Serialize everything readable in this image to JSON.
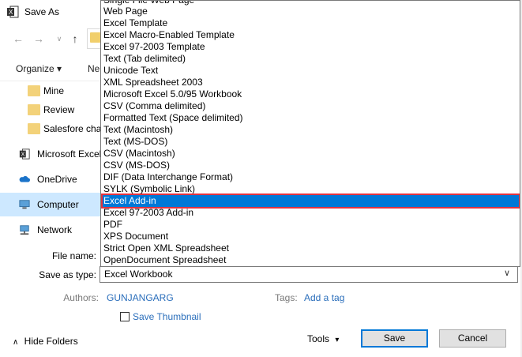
{
  "window": {
    "title": "Save As"
  },
  "nav": {
    "items": [
      {
        "label": "Mine",
        "icon": "folder-icon"
      },
      {
        "label": "Review",
        "icon": "folder-icon"
      },
      {
        "label": "Salesfore chal",
        "icon": "folder-icon"
      },
      {
        "label": "Microsoft Excel",
        "icon": "excel-icon"
      },
      {
        "label": "OneDrive",
        "icon": "cloud-icon"
      },
      {
        "label": "Computer",
        "icon": "computer-icon",
        "selected": true
      },
      {
        "label": "Network",
        "icon": "network-icon"
      }
    ]
  },
  "toolbar": {
    "organize": "Organize ▾",
    "new_folder": "Ne"
  },
  "dropdown": {
    "top_partial": "Single File Web Page",
    "items": [
      "Web Page",
      "Excel Template",
      "Excel Macro-Enabled Template",
      "Excel 97-2003 Template",
      "Text (Tab delimited)",
      "Unicode Text",
      "XML Spreadsheet 2003",
      "Microsoft Excel 5.0/95 Workbook",
      "CSV (Comma delimited)",
      "Formatted Text (Space delimited)",
      "Text (Macintosh)",
      "Text (MS-DOS)",
      "CSV (Macintosh)",
      "CSV (MS-DOS)",
      "DIF (Data Interchange Format)",
      "SYLK (Symbolic Link)",
      "Excel Add-in",
      "Excel 97-2003 Add-in",
      "PDF",
      "XPS Document",
      "Strict Open XML Spreadsheet",
      "OpenDocument Spreadsheet"
    ],
    "selected": "Excel Add-in"
  },
  "form": {
    "file_name_label": "File name:",
    "save_as_type_label": "Save as type:",
    "save_as_type_value": "Excel Workbook",
    "authors_label": "Authors:",
    "authors_value": "GUNJANGARG",
    "tags_label": "Tags:",
    "tags_value": "Add a tag",
    "save_thumbnail_label": "Save Thumbnail"
  },
  "footer": {
    "hide_folders": "Hide Folders",
    "tools": "Tools",
    "save": "Save",
    "cancel": "Cancel"
  },
  "colors": {
    "accent": "#0078d7",
    "highlight_border": "#e2323f",
    "link": "#2a6ebb"
  }
}
